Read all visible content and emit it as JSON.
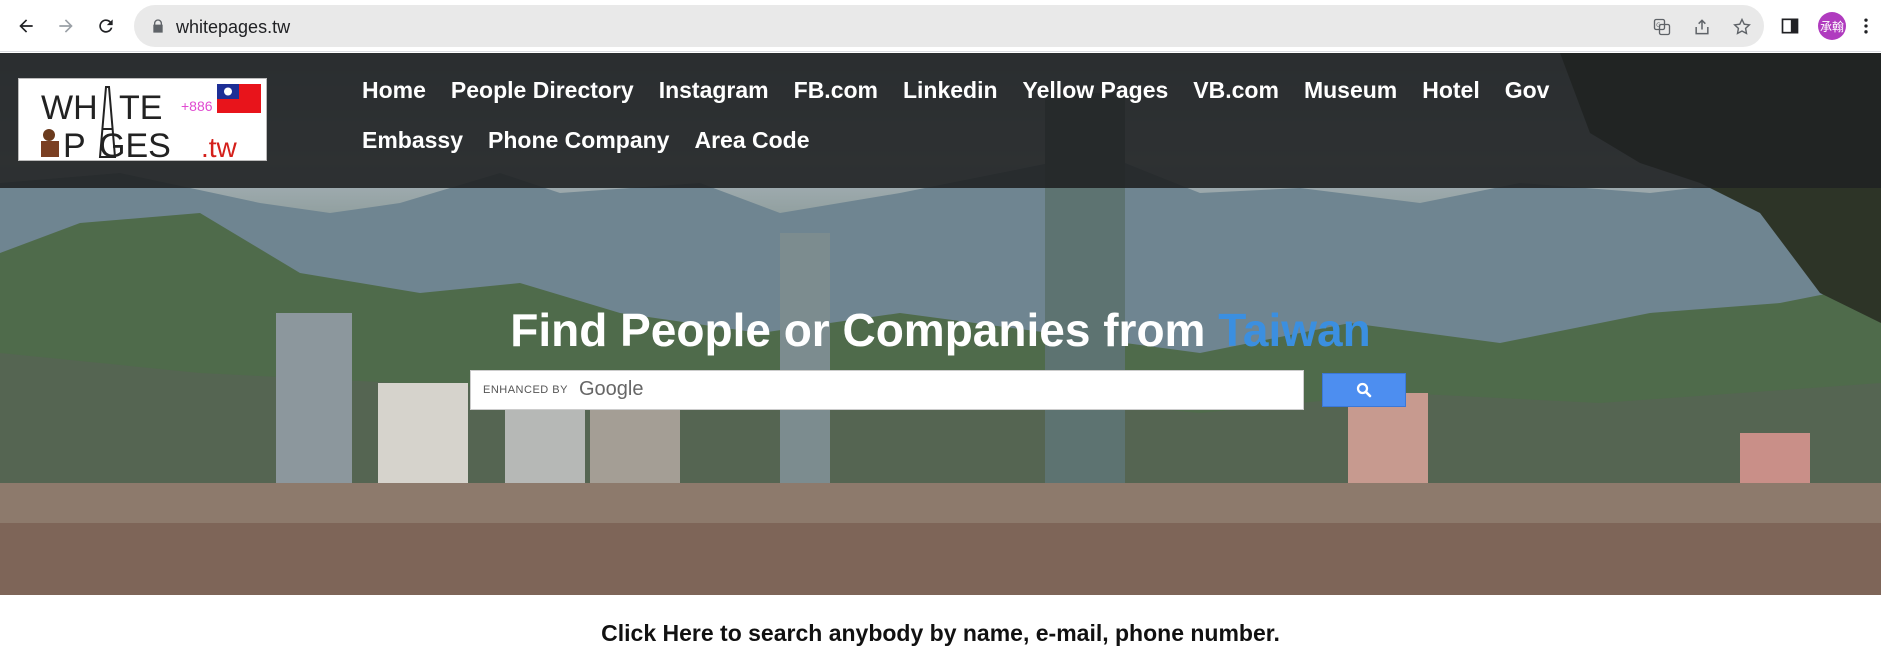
{
  "browser": {
    "url": "whitepages.tw",
    "profile_initials": "承翰"
  },
  "logo": {
    "line1": "WHITE",
    "line2": "PAGES",
    "tld": ".tw",
    "country_code": "+886"
  },
  "menu": {
    "items": [
      {
        "label": "Home"
      },
      {
        "label": "People Directory"
      },
      {
        "label": "Instagram"
      },
      {
        "label": "FB.com"
      },
      {
        "label": "Linkedin"
      },
      {
        "label": "Yellow Pages"
      },
      {
        "label": "VB.com"
      },
      {
        "label": "Museum"
      },
      {
        "label": "Hotel"
      },
      {
        "label": "Gov"
      },
      {
        "label": "Embassy"
      },
      {
        "label": "Phone Company"
      },
      {
        "label": "Area Code"
      }
    ]
  },
  "hero": {
    "headline_main": "Find People or Companies from ",
    "headline_accent": "Taiwan",
    "search_enhanced": "ENHANCED BY",
    "search_brand": "Google"
  },
  "footer_cta": "Click Here to search anybody by name, e-mail, phone number.",
  "colors": {
    "accent": "#3b8fe0",
    "search_button": "#4d8ef0",
    "topbar": "#202224",
    "avatar": "#b03bbf"
  }
}
